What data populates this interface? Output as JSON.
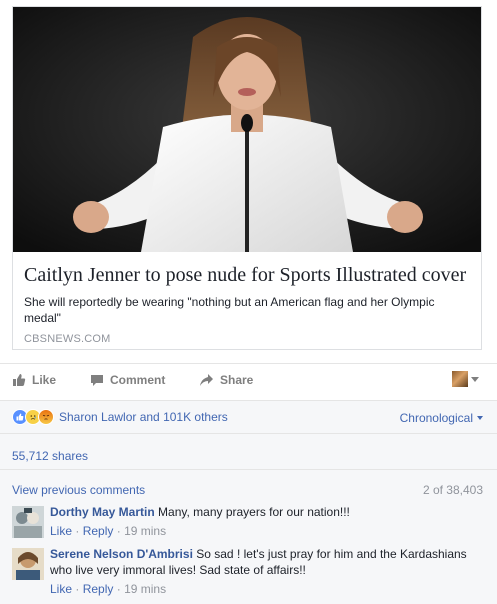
{
  "link_card": {
    "title": "Caitlyn Jenner to pose nude for Sports Illustrated cover",
    "description": "She will reportedly be wearing \"nothing but an American flag and her Olympic medal\"",
    "domain": "CBSNEWS.COM",
    "image_icon": "article-photo"
  },
  "actions": {
    "like_label": "Like",
    "comment_label": "Comment",
    "share_label": "Share",
    "like_icon": "thumbs-up-icon",
    "comment_icon": "speech-bubble-icon",
    "share_icon": "share-arrow-icon"
  },
  "reactions": {
    "summary": "Sharon Lawlor and 101K others",
    "types": [
      "like",
      "sad",
      "angry"
    ],
    "sort_label": "Chronological"
  },
  "shares": "55,712 shares",
  "comments": {
    "view_previous": "View previous comments",
    "count": "2 of 38,403",
    "items": [
      {
        "author": "Dorthy May Martin",
        "text": "Many, many prayers for our nation!!!",
        "like": "Like",
        "reply": "Reply",
        "time": "19 mins"
      },
      {
        "author": "Serene Nelson D'Ambrisi",
        "text": "So sad ! let's just pray for him and the Kardashians who live very immoral lives! Sad state of affairs!!",
        "like": "Like",
        "reply": "Reply",
        "time": "19 mins"
      }
    ]
  },
  "colors": {
    "link_blue": "#4267b2",
    "name_blue": "#365899",
    "muted_gray": "#90949c",
    "action_gray": "#7f7f7f",
    "ufi_background": "#f6f7f9"
  }
}
